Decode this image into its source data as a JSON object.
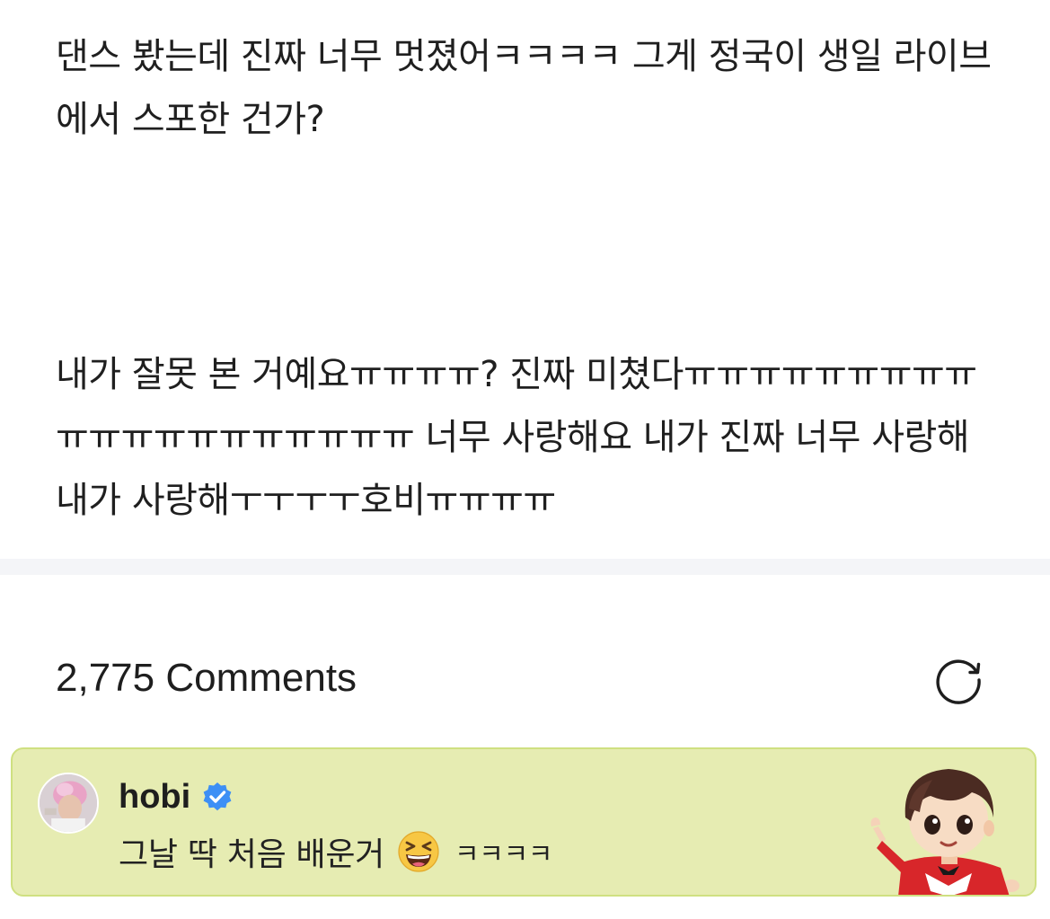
{
  "post": {
    "paragraph_1": "댄스 봤는데 진짜 너무 멋졌어ㅋㅋㅋㅋ 그게 정국이 생일 라이브에서 스포한 건가?",
    "paragraph_2": "내가 잘못 본 거예요ㅠㅠㅠㅠ? 진짜 미쳤다ㅠㅠㅠㅠㅠㅠㅠㅠㅠㅠㅠㅠㅠㅠㅠㅠㅠㅠㅠㅠ 너무 사랑해요 내가 진짜 너무 사랑해 내가 사랑해ㅜㅜㅜㅜ호비ㅠㅠㅠㅠ"
  },
  "comments": {
    "count_label": "2,775 Comments",
    "refresh_icon": "refresh-icon",
    "artist_comment": {
      "author": "hobi",
      "verified_icon": "verified-badge-icon",
      "text": "그날 딱 처음 배운거",
      "emoji_icon": "grinning-squinting-face-emoji",
      "laugh": "ㅋㅋㅋㅋ",
      "sticker_icon": "character-sticker",
      "background_color": "#e6ecb2",
      "border_color": "#cfe081",
      "verified_color": "#3d8ff5"
    }
  }
}
